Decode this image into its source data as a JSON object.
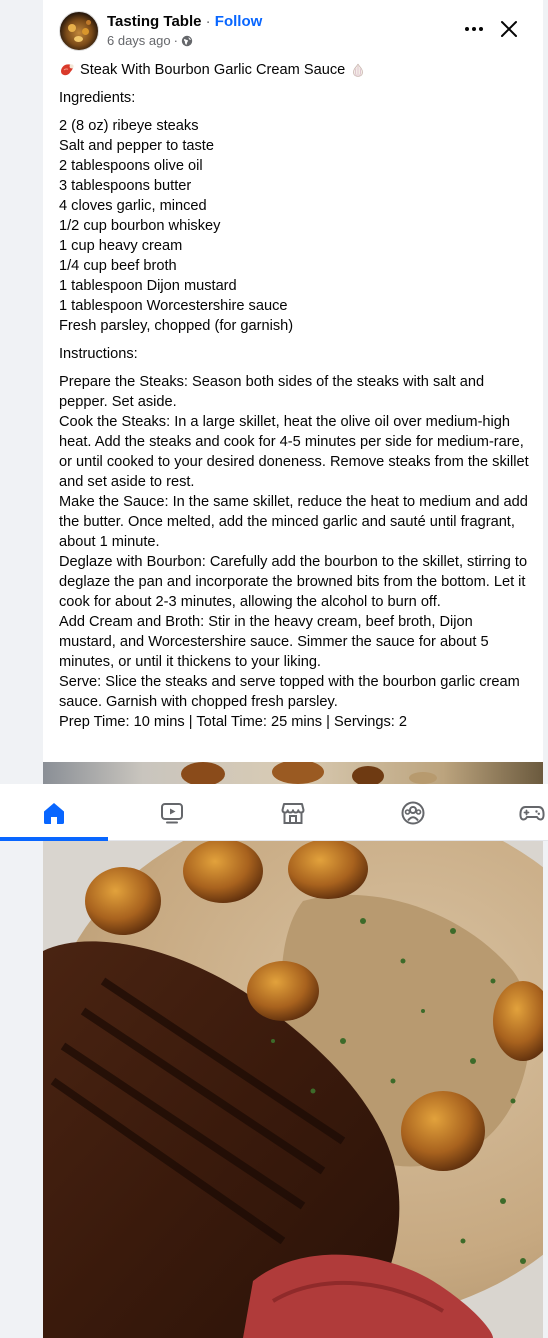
{
  "post": {
    "author": "Tasting Table",
    "separator": "·",
    "follow_label": "Follow",
    "timestamp": "6 days ago",
    "meta_separator": "·",
    "privacy_icon": "globe-icon",
    "title": "Steak With Bourbon Garlic Cream Sauce",
    "title_leading_icon": "steak-emoji-icon",
    "title_trailing_icon": "garlic-emoji-icon",
    "ingredients_heading": "Ingredients:",
    "ingredients": [
      "2 (8 oz) ribeye steaks",
      "Salt and pepper to taste",
      "2 tablespoons olive oil",
      "3 tablespoons butter",
      "4 cloves garlic, minced",
      "1/2 cup bourbon whiskey",
      "1 cup heavy cream",
      "1/4 cup beef broth",
      "1 tablespoon Dijon mustard",
      "1 tablespoon Worcestershire sauce",
      "Fresh parsley, chopped (for garnish)"
    ],
    "instructions_heading": "Instructions:",
    "instructions": [
      "Prepare the Steaks: Season both sides of the steaks with salt and pepper. Set aside.",
      "Cook the Steaks: In a large skillet, heat the olive oil over medium-high heat. Add the steaks and cook for 4-5 minutes per side for medium-rare, or until cooked to your desired doneness. Remove steaks from the skillet and set aside to rest.",
      "Make the Sauce: In the same skillet, reduce the heat to medium and add the butter. Once melted, add the minced garlic and sauté until fragrant, about 1 minute.",
      "Deglaze with Bourbon: Carefully add the bourbon to the skillet, stirring to deglaze the pan and incorporate the browned bits from the bottom. Let it cook for about 2-3 minutes, allowing the alcohol to burn off.",
      "Add Cream and Broth: Stir in the heavy cream, beef broth, Dijon mustard, and Worcestershire sauce. Simmer the sauce for about 5 minutes, or until it thickens to your liking.",
      "Serve: Slice the steaks and serve topped with the bourbon garlic cream sauce. Garnish with chopped fresh parsley."
    ],
    "summary": "Prep Time: 10 mins | Total Time: 25 mins | Servings: 2"
  },
  "nav": {
    "items": [
      {
        "icon": "home-icon",
        "active": true
      },
      {
        "icon": "video-icon",
        "active": false
      },
      {
        "icon": "marketplace-icon",
        "active": false
      },
      {
        "icon": "groups-icon",
        "active": false
      },
      {
        "icon": "gaming-icon",
        "active": false
      }
    ]
  },
  "colors": {
    "accent": "#0866ff",
    "text": "#050505",
    "secondary_text": "#65676b",
    "background": "#f0f2f5"
  }
}
